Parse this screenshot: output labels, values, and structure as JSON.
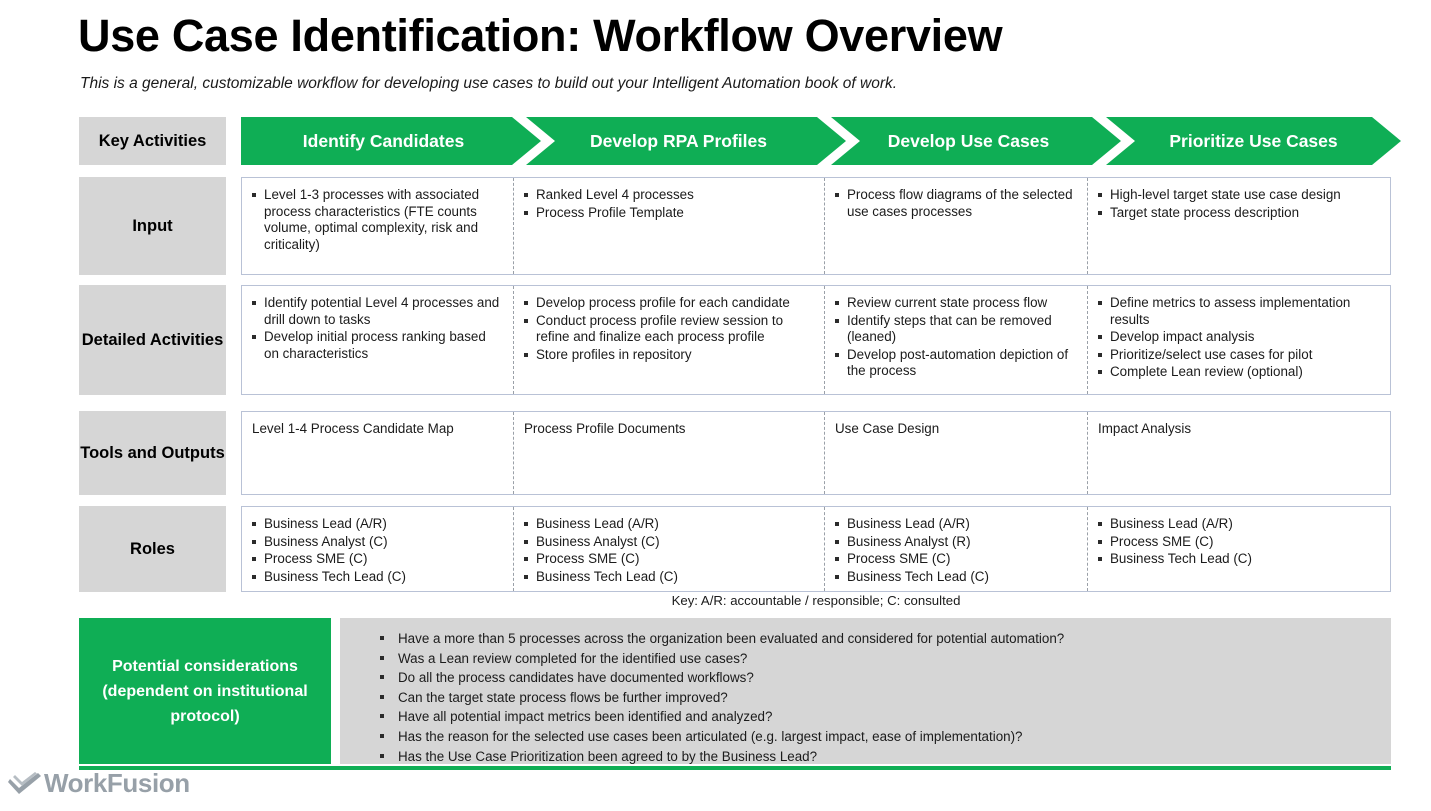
{
  "header": {
    "title": "Use Case Identification: Workflow Overview",
    "subtitle": "This is a general, customizable workflow for developing use cases to build out your Intelligent Automation book of work."
  },
  "colors": {
    "accent_green": "#0fae55",
    "label_grey": "#d6d6d6",
    "panel_grey": "#d6d6d6",
    "box_border": "#b9c2d6",
    "divider": "#9aa0a8",
    "logo_grey": "#97a0a8"
  },
  "matrix": {
    "corner_label": "Key Activities",
    "phases": [
      {
        "label": "Identify Candidates"
      },
      {
        "label": "Develop RPA Profiles"
      },
      {
        "label": "Develop Use Cases"
      },
      {
        "label": "Prioritize Use Cases"
      }
    ],
    "rows": [
      {
        "label": "Input",
        "cells": [
          {
            "type": "bullets",
            "items": [
              "Level 1-3 processes with associated process characteristics (FTE counts volume, optimal complexity, risk and criticality)"
            ]
          },
          {
            "type": "bullets",
            "items": [
              "Ranked Level 4 processes",
              "Process Profile Template"
            ]
          },
          {
            "type": "bullets",
            "items": [
              "Process flow diagrams of the selected use cases processes"
            ]
          },
          {
            "type": "bullets",
            "items": [
              "High-level target state use case design",
              "Target state process description"
            ]
          }
        ]
      },
      {
        "label": "Detailed Activities",
        "cells": [
          {
            "type": "bullets",
            "items": [
              "Identify potential Level 4 processes and drill down to tasks",
              "Develop initial process  ranking based on characteristics"
            ]
          },
          {
            "type": "bullets",
            "items": [
              "Develop process profile for each candidate",
              "Conduct process profile review session to refine and finalize each process profile",
              "Store profiles in repository"
            ]
          },
          {
            "type": "bullets",
            "items": [
              "Review current state process flow",
              "Identify steps that can be removed (leaned)",
              "Develop post-automation depiction of the process"
            ]
          },
          {
            "type": "bullets",
            "items": [
              "Define metrics to assess implementation results",
              "Develop impact analysis",
              "Prioritize/select use cases for pilot",
              "Complete Lean review (optional)"
            ]
          }
        ]
      },
      {
        "label": "Tools and Outputs",
        "cells": [
          {
            "type": "text",
            "text": "Level 1-4 Process Candidate Map"
          },
          {
            "type": "text",
            "text": "Process Profile Documents"
          },
          {
            "type": "text",
            "text": "Use Case Design"
          },
          {
            "type": "text",
            "text": "Impact Analysis"
          }
        ]
      },
      {
        "label": "Roles",
        "cells": [
          {
            "type": "bullets",
            "items": [
              "Business Lead (A/R)",
              "Business Analyst (C)",
              "Process SME (C)",
              "Business Tech Lead (C)"
            ]
          },
          {
            "type": "bullets",
            "items": [
              "Business Lead (A/R)",
              "Business Analyst (C)",
              "Process SME (C)",
              "Business Tech Lead (C)"
            ]
          },
          {
            "type": "bullets",
            "items": [
              "Business Lead (A/R)",
              "Business Analyst (R)",
              "Process SME (C)",
              "Business Tech Lead (C)"
            ]
          },
          {
            "type": "bullets",
            "items": [
              "Business Lead (A/R)",
              "Process SME (C)",
              "Business Tech Lead (C)"
            ]
          }
        ]
      }
    ],
    "key_note": "Key: A/R: accountable / responsible; C: consulted"
  },
  "considerations": {
    "label": "Potential considerations (dependent on institutional protocol)",
    "items": [
      "Have a more than 5 processes across the organization been evaluated and considered for potential automation?",
      "Was a Lean review completed for the identified use cases?",
      "Do all the process candidates have documented workflows?",
      "Can the target state process flows be further improved?",
      "Have all potential impact metrics been identified and analyzed?",
      "Has the reason for the selected use cases been articulated (e.g. largest impact, ease of implementation)?",
      "Has the Use Case Prioritization been agreed to by the Business Lead?"
    ]
  },
  "footer": {
    "logo_text": "WorkFusion"
  }
}
